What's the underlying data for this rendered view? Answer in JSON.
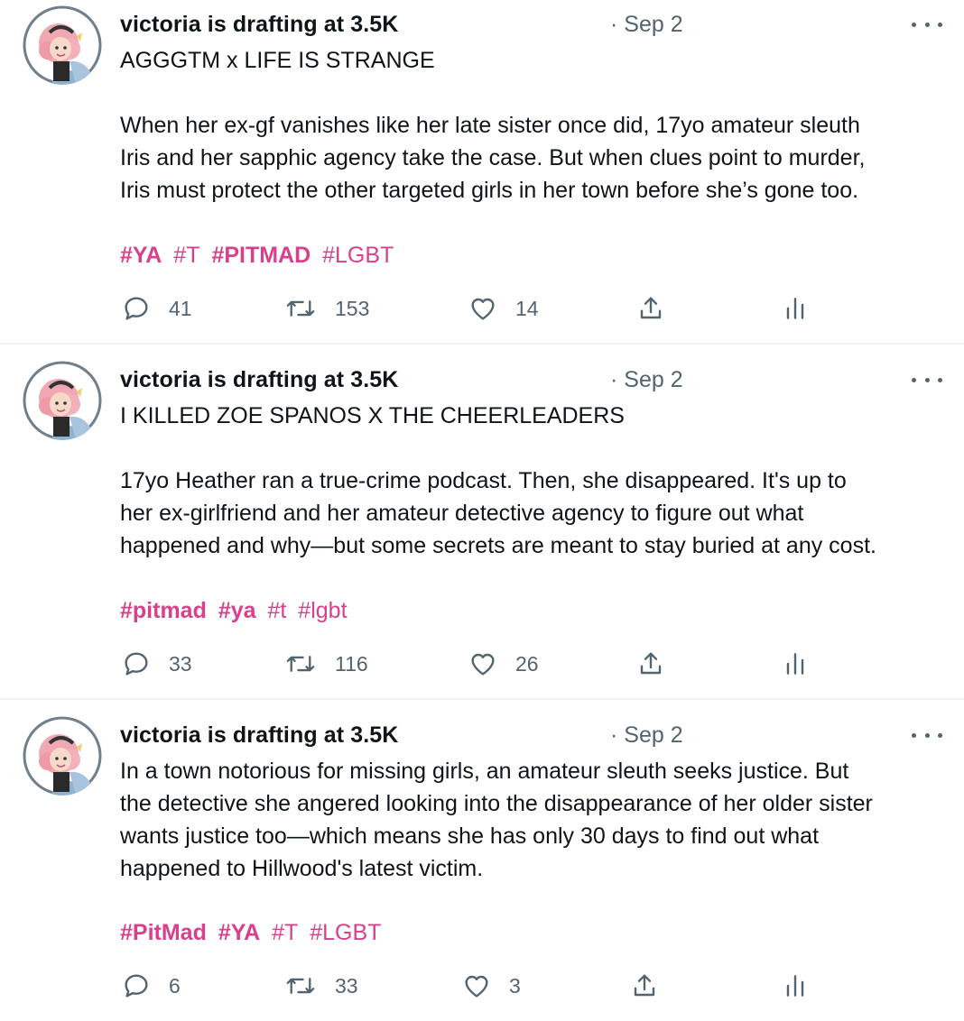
{
  "tweets": [
    {
      "author": "victoria is drafting at 3.5K",
      "date": "· Sep 2",
      "headline": "AGGGTM x LIFE IS STRANGE",
      "body": "When her ex-gf vanishes like her late sister once did, 17yo amateur sleuth\nIris and her sapphic agency take the case. But when clues point to murder,\nIris must protect the other targeted girls in her town before she’s gone too.",
      "tags": [
        {
          "text": "#YA",
          "bold": true
        },
        {
          "text": "#T",
          "bold": false
        },
        {
          "text": "#PITMAD",
          "bold": true
        },
        {
          "text": "#LGBT",
          "bold": false
        }
      ],
      "replies": "41",
      "retweets": "153",
      "likes": "14"
    },
    {
      "author": "victoria is drafting at 3.5K",
      "date": "· Sep 2",
      "headline": "I KILLED ZOE SPANOS X THE CHEERLEADERS",
      "body": "17yo Heather ran a true-crime podcast. Then, she disappeared. It's up to\nher ex-girlfriend and her amateur detective agency to figure out what\nhappened and why—but some secrets are meant to stay buried at any cost.",
      "tags": [
        {
          "text": "#pitmad",
          "bold": true
        },
        {
          "text": "#ya",
          "bold": true
        },
        {
          "text": "#t",
          "bold": false
        },
        {
          "text": "#lgbt",
          "bold": false
        }
      ],
      "replies": "33",
      "retweets": "116",
      "likes": "26"
    },
    {
      "author": "victoria is drafting at 3.5K",
      "date": "· Sep 2",
      "headline": "",
      "body": "In a town notorious for missing girls, an amateur sleuth seeks justice. But\nthe detective she angered looking into the disappearance of her older sister\nwants justice too—which means she has only 30 days to find out what\nhappened to Hillwood's latest victim.",
      "tags": [
        {
          "text": "#PitMad",
          "bold": true
        },
        {
          "text": "#YA",
          "bold": true
        },
        {
          "text": "#T",
          "bold": false
        },
        {
          "text": "#LGBT",
          "bold": false
        }
      ],
      "replies": "6",
      "retweets": "33",
      "likes": "3"
    }
  ],
  "colors": {
    "text": "#0f1419",
    "secondary": "#536471",
    "hashtag": "#d9408c",
    "divider": "#eff3f4"
  },
  "icons": [
    "reply-icon",
    "retweet-icon",
    "like-icon",
    "share-icon",
    "analytics-icon",
    "more-icon"
  ]
}
